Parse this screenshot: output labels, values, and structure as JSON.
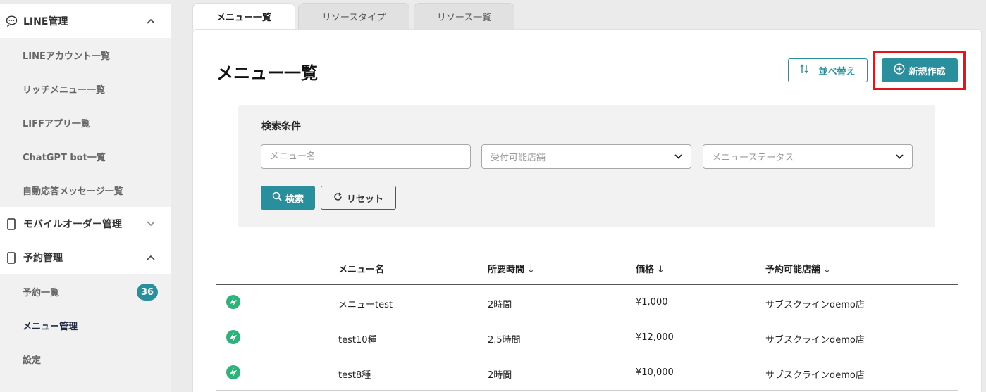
{
  "sidebar": {
    "groups": [
      {
        "label": "LINE管理",
        "icon": "chat-bubble-icon",
        "chevron": "^"
      },
      {
        "label": "モバイルオーダー管理",
        "icon": "smartphone-icon",
        "chevron": "⌄"
      },
      {
        "label": "予約管理",
        "icon": "smartphone-icon",
        "chevron": "^"
      }
    ],
    "line_items": [
      "LINEアカウント一覧",
      "リッチメニュー一覧",
      "LIFFアプリ一覧",
      "ChatGPT bot一覧",
      "自動応答メッセージ一覧"
    ],
    "reserve_items": [
      {
        "label": "予約一覧",
        "badge": "36"
      },
      {
        "label": "メニュー管理"
      },
      {
        "label": "設定"
      }
    ]
  },
  "tabs": [
    "メニュー一覧",
    "リソースタイプ",
    "リソース一覧"
  ],
  "page": {
    "title": "メニュー一覧",
    "sort_label": "並べ替え",
    "new_label": "新規作成"
  },
  "search": {
    "title": "検索条件",
    "menu_name_placeholder": "メニュー名",
    "store_placeholder": "受付可能店舗",
    "status_placeholder": "メニューステータス",
    "search_label": "検索",
    "reset_label": "リセット"
  },
  "table": {
    "headers": {
      "name": "メニュー名",
      "duration": "所要時間",
      "price": "価格",
      "stores": "予約可能店舗"
    },
    "sort_arrow": "↓",
    "rows": [
      {
        "name": "メニューtest",
        "duration": "2時間",
        "price": "¥1,000",
        "store": "サブスクラインdemo店"
      },
      {
        "name": "test10種",
        "duration": "2.5時間",
        "price": "¥12,000",
        "store": "サブスクラインdemo店"
      },
      {
        "name": "test8種",
        "duration": "2時間",
        "price": "¥10,000",
        "store": "サブスクラインdemo店"
      }
    ]
  },
  "colors": {
    "accent": "#2a8f9c",
    "highlight": "#e4161b",
    "row_icon": "#2bb37a"
  }
}
